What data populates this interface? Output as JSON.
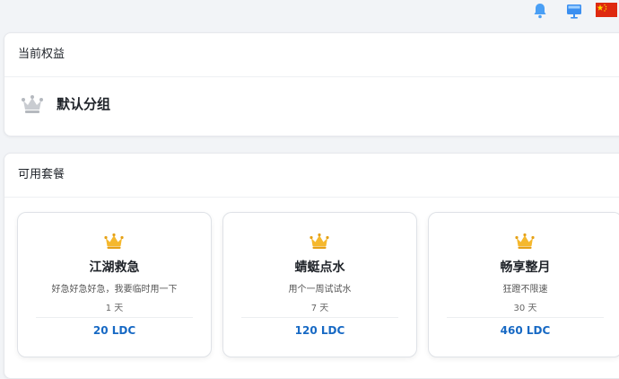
{
  "topbar": {
    "icons": [
      "bell-icon",
      "monitor-icon",
      "china-flag-icon"
    ]
  },
  "rights": {
    "title": "当前权益",
    "group_name": "默认分组",
    "icon": "crown-icon"
  },
  "plans": {
    "title": "可用套餐",
    "items": [
      {
        "name": "江湖救急",
        "description": "好急好急好急，我要临时用一下",
        "duration": "1 天",
        "price": "20 LDC"
      },
      {
        "name": "蜻蜓点水",
        "description": "用个一周试试水",
        "duration": "7 天",
        "price": "120 LDC"
      },
      {
        "name": "畅享整月",
        "description": "狂蹬不限速",
        "duration": "30 天",
        "price": "460 LDC"
      }
    ]
  },
  "colors": {
    "accent": "#1769c4",
    "crown_gold": "#f5b82e",
    "crown_grey": "#c9ccd1",
    "bell": "#4a9ff5"
  }
}
